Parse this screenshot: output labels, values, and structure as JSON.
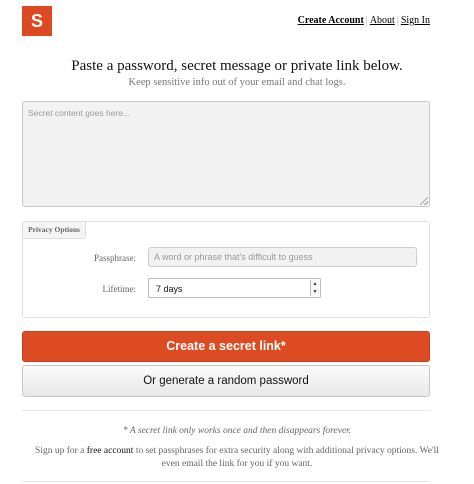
{
  "logo": {
    "letter": "S",
    "color": "#dd4a22"
  },
  "nav": {
    "create_account": "Create Account",
    "separator": "|",
    "about": "About",
    "sign_in": "Sign In"
  },
  "heading": "Paste a password, secret message or private link below.",
  "subheading": "Keep sensitive info out of your email and chat logs.",
  "secret": {
    "placeholder": "Secret content goes here...",
    "value": ""
  },
  "privacy": {
    "legend": "Privacy Options",
    "passphrase_label": "Passphrase:",
    "passphrase_placeholder": "A word or phrase that's difficult to guess",
    "lifetime_label": "Lifetime:",
    "lifetime_value": "7 days"
  },
  "buttons": {
    "create": "Create a secret link*",
    "generate": "Or generate a random password",
    "accent": "#dd4b22"
  },
  "footer": {
    "note": "* A secret link only works once and then disappears forever.",
    "signup_prefix": "Sign up for a ",
    "signup_link": "free account",
    "signup_suffix": " to set passphrases for extra security along with additional privacy options. We'll even email the link for you if you want."
  }
}
